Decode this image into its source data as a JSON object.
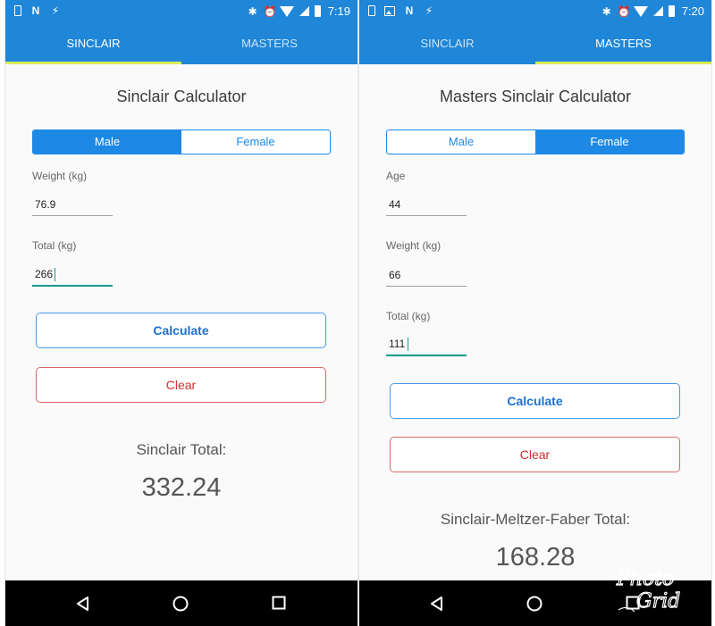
{
  "left": {
    "status": {
      "time": "7:19",
      "left_icons": [
        "screen-icon",
        "n-icon",
        "bolt-icon"
      ],
      "right_icons": [
        "bluetooth-icon",
        "alarm-icon",
        "wifi-icon",
        "signal-icon",
        "battery-icon"
      ]
    },
    "tabs": [
      {
        "label": "SINCLAIR",
        "active": true
      },
      {
        "label": "MASTERS",
        "active": false
      }
    ],
    "title": "Sinclair Calculator",
    "gender": {
      "options": [
        "Male",
        "Female"
      ],
      "selected": "Male"
    },
    "fields": [
      {
        "label": "Weight (kg)",
        "value": "76.9"
      },
      {
        "label": "Total (kg)",
        "value": "266"
      }
    ],
    "buttons": {
      "calculate": "Calculate",
      "clear": "Clear"
    },
    "result": {
      "label": "Sinclair Total:",
      "value": "332.24"
    }
  },
  "right": {
    "status": {
      "time": "7:20",
      "left_icons": [
        "screen-icon",
        "image-icon",
        "n-icon",
        "bolt-icon"
      ],
      "right_icons": [
        "bluetooth-icon",
        "alarm-icon",
        "wifi-icon",
        "signal-icon",
        "battery-icon"
      ]
    },
    "tabs": [
      {
        "label": "SINCLAIR",
        "active": false
      },
      {
        "label": "MASTERS",
        "active": true
      }
    ],
    "title": "Masters Sinclair Calculator",
    "gender": {
      "options": [
        "Male",
        "Female"
      ],
      "selected": "Female"
    },
    "fields": [
      {
        "label": "Age",
        "value": "44"
      },
      {
        "label": "Weight (kg)",
        "value": "66"
      },
      {
        "label": "Total (kg)",
        "value": "111"
      }
    ],
    "buttons": {
      "calculate": "Calculate",
      "clear": "Clear"
    },
    "result": {
      "label": "Sinclair-Meltzer-Faber Total:",
      "value": "168.28"
    }
  },
  "navbar": {
    "icons": [
      "back-icon",
      "home-icon",
      "recents-icon"
    ]
  },
  "watermark": {
    "text": "Photo Grid"
  },
  "colors": {
    "app_bar": "#1f86d8",
    "tab_indicator": "#d8ec58",
    "accent": "#1e88e5",
    "clear": "#d32f2f",
    "focus": "#1a9a8c"
  }
}
